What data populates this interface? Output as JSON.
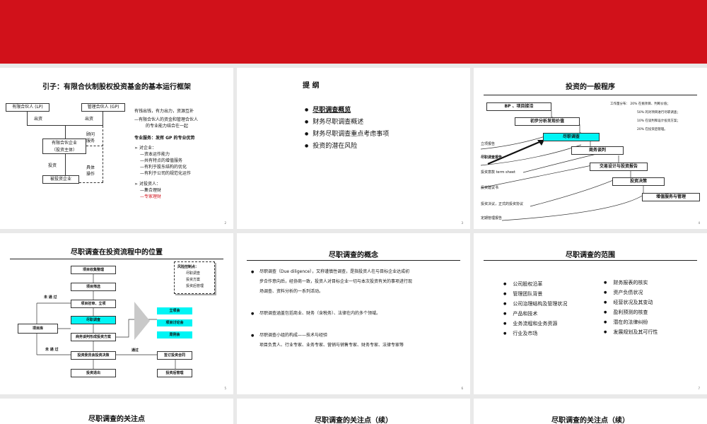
{
  "s2": {
    "title": "引子：有限合伙制股权投资基金的基本运行框架",
    "lp": "有限合伙人 (LP)",
    "gp": "管理合伙人 (GP)",
    "chuzi1": "出资",
    "chuzi2": "出资",
    "guwen": "顾问",
    "fuwu": "服务",
    "fund": "有限合伙企业",
    "fund_sub": "（投资主体）",
    "touzi": "投资",
    "juti": "具体",
    "caozuo": "操作",
    "target": "被投资企业",
    "r1": "有钱出钱，有力出力，资源互补",
    "r2": "—有限合伙人的资金和管理合伙人",
    "r3": "的专业能力结合在一起",
    "r4": "专业服务：发挥 GP 的专业优势",
    "r5": "对企业：",
    "r6": "—资本运作能力",
    "r7": "—共有特点的增值服务",
    "r8": "—有利于股东结构的优化",
    "r9": "—有利于公司的规范化运作",
    "r10": "对投资人：",
    "r11": "—集合理财",
    "r12": "—专家理财",
    "page": "2"
  },
  "s3": {
    "title": "提 纲",
    "items": [
      "尽职调查概览",
      "财务尽职调查概述",
      "财务尽职调查重点考虑事项",
      "投资的潜在风险"
    ],
    "page": "3"
  },
  "s4": {
    "title": "投资的一般程序",
    "steps": [
      "BP 、项目接洽",
      "初步分析发现价值",
      "尽职调查",
      "商务谈判",
      "交易设计与投资报告",
      "投资决策",
      "增值服务与管理"
    ],
    "left": [
      "立项报告",
      "尽职调查报告",
      "投资意款  term sheet",
      "投资建议书",
      "投资决议，正式的投资协议",
      "定期管理报告"
    ],
    "notes": [
      "工作量分布： 20% 在挑项目、判断价值；",
      "50% 的对项目进行尽职调查；",
      "10% 在谈判和设计投资方案；",
      "20% 在投资后管理。"
    ],
    "page": "4"
  },
  "s5": {
    "title": "尽职调查在投资流程中的位置",
    "flow": [
      "项目收集整理",
      "项目筛选",
      "项目初审、立项",
      "尽职调查",
      "商务谈判形成投资方案",
      "投资委员会投资决策",
      "投资退出"
    ],
    "repo": "项目库",
    "no1": "未 通 过",
    "no2": "未 通 过",
    "pass": "通过",
    "sign": "签订投资合同",
    "post": "投资后管理",
    "risk_title": "风险控制点：",
    "risk": [
      "尽职调查",
      "投资方案",
      "投资后管理"
    ],
    "meetings": [
      "立项会",
      "项目讨论会",
      "周例会"
    ],
    "page": "5"
  },
  "s6": {
    "title": "尽职调查的概念",
    "p1a": "尽职调查（Due diligence），又称谨慎性调查，是指投资人在与目标企业达成初",
    "p1b": "步合作意向后，经协商一致，投资人对目标企业一切与本次投资有关的事项进行现",
    "p1c": "场调查、资料分析的一系列活动。",
    "p2": "尽职调查涵盖包括商业、财务（含税务）、法律在内的多个领域。",
    "p3a": "尽职调查小组的构成——技术与经验",
    "p3b": "项目负责人、行业专家、业务专家、营销与销售专家、财务专家、法律专家等",
    "page": "6"
  },
  "s7": {
    "title": "尽职调查的范围",
    "left": [
      "公司股权沿革",
      "管理团队背景",
      "公司治理结构及管理状况",
      "产品和技术",
      "业务流程和业务资源",
      "行业及市场"
    ],
    "right": [
      "财务报表的核实",
      "资产负债状况",
      "经营状况及其变动",
      "盈利预测的核查",
      "潜在的法律纠纷",
      "发展规划及其可行性"
    ],
    "page": "7"
  },
  "s8": {
    "title": "尽职调查的关注点"
  },
  "s9": {
    "title": "尽职调查的关注点（续）"
  },
  "s10": {
    "title": "尽职调查的关注点（续）"
  }
}
